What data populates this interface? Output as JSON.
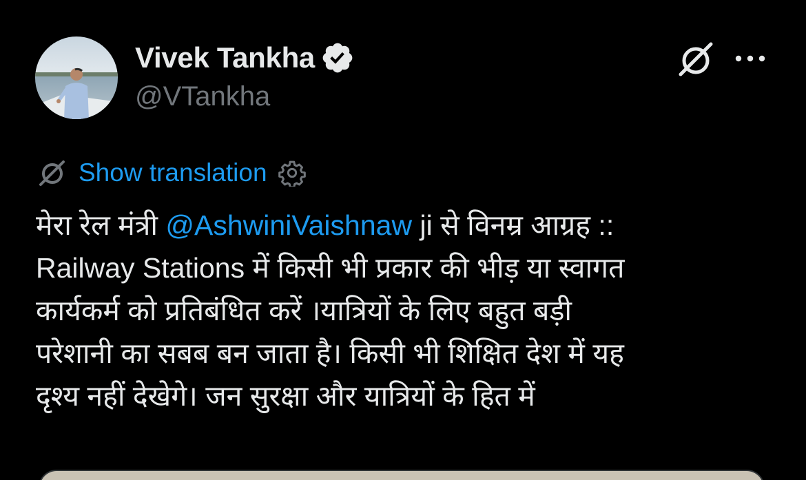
{
  "author": {
    "display_name": "Vivek Tankha",
    "handle": "@VTankha",
    "verified": true,
    "avatar_icon": "profile-photo"
  },
  "actions": {
    "grok_icon": "grok-icon",
    "more_icon": "more-horizontal-icon"
  },
  "translation": {
    "label": "Show translation",
    "icon": "grok-icon",
    "settings_icon": "gear-icon"
  },
  "tweet": {
    "line1_before": "मेरा रेल मंत्री ",
    "mention": "@AshwiniVaishnaw",
    "line1_after": " ji से विनम्र आग्रह ::",
    "line2": "Railway Stations में किसी भी प्रकार की भीड़ या स्वागत",
    "line3": "कार्यकर्म को प्रतिबंधित करें ।यात्रियों के लिए बहुत बड़ी",
    "line4": "परेशानी का सबब बन जाता है। किसी भी शिक्षित देश में यह",
    "line5": "दृश्य नहीं देखेगे। जन सुरक्षा और यात्रियों के हित में"
  },
  "colors": {
    "background": "#000000",
    "text_primary": "#e7e9ea",
    "text_secondary": "#71767b",
    "accent": "#1d9bf0"
  }
}
